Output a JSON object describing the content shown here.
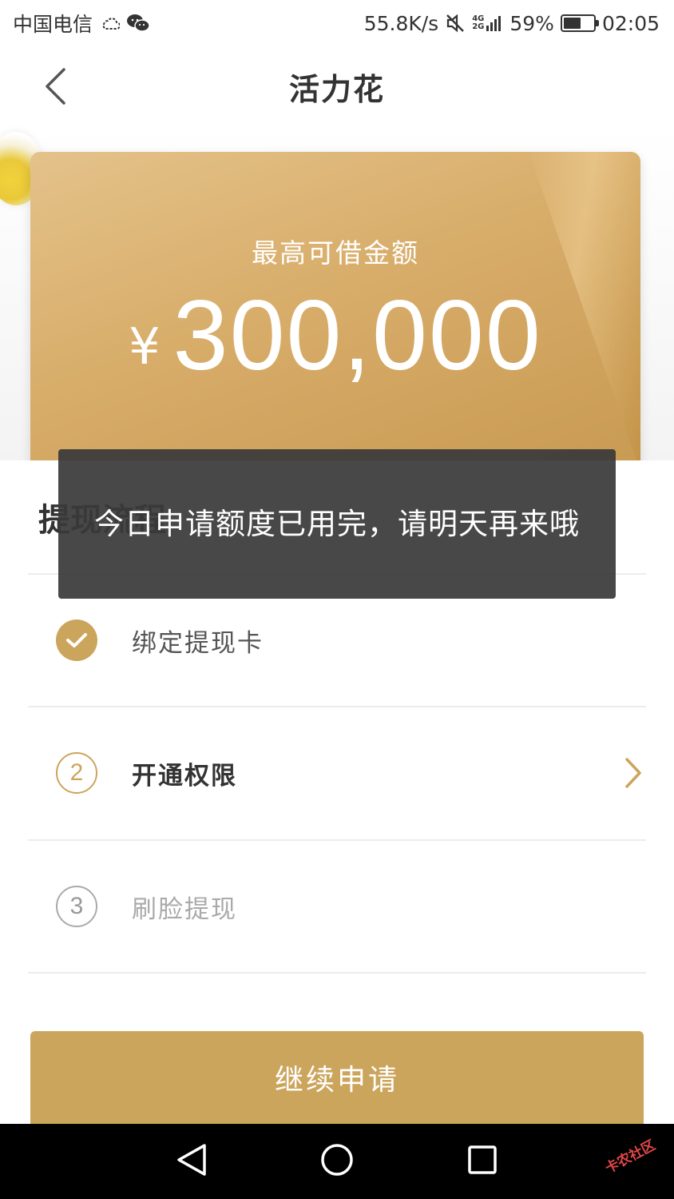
{
  "status_bar": {
    "carrier": "中国电信",
    "network_speed": "55.8K/s",
    "signal_top": "4G",
    "signal_bottom": "2G",
    "battery_percent": "59%",
    "battery_level": 0.59,
    "time": "02:05",
    "icons": [
      "weather-icon",
      "wechat-icon",
      "mute-icon",
      "signal-icon",
      "battery-icon"
    ]
  },
  "nav": {
    "title": "活力花",
    "back_icon": "chevron-left-icon"
  },
  "card": {
    "label": "最高可借金额",
    "currency": "¥",
    "amount": "300,000"
  },
  "section": {
    "title": "提现流程"
  },
  "steps": [
    {
      "badge": "",
      "label": "绑定提现卡",
      "status": "completed",
      "icon": "check-icon"
    },
    {
      "badge": "2",
      "label": "开通权限",
      "status": "current",
      "icon": "chevron-right-icon"
    },
    {
      "badge": "3",
      "label": "刷脸提现",
      "status": "pending"
    }
  ],
  "primary_button": {
    "label": "继续申请"
  },
  "toast": {
    "message": "今日申请额度已用完，请明天再来哦"
  },
  "system_nav": {
    "icons": [
      "back-triangle-icon",
      "home-circle-icon",
      "recents-square-icon"
    ]
  },
  "watermark": {
    "text": "卡农社区"
  },
  "colors": {
    "gold": "#cca55c",
    "gold_light": "#e4c28a",
    "text_primary": "#333333",
    "text_muted": "#aaaaaa",
    "toast_bg": "#3a3a3a"
  }
}
